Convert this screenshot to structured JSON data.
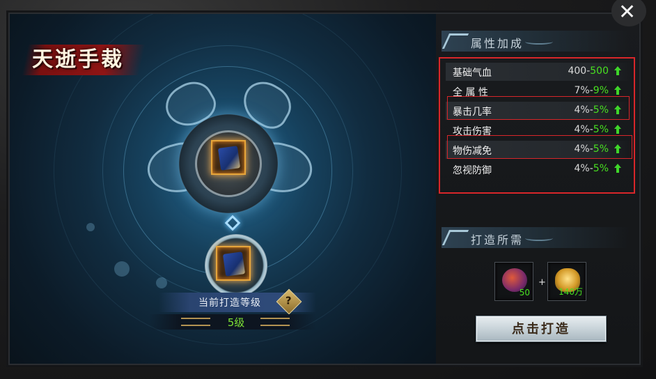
{
  "title": "天逝手裁",
  "close_icon": "close-x-icon",
  "attributes_section": {
    "header": "属性加成",
    "rows": [
      {
        "name": "基础气血",
        "from": "400",
        "to": "500"
      },
      {
        "name": "全 属 性",
        "from": "7%",
        "to": "9%"
      },
      {
        "name": "暴击几率",
        "from": "4%",
        "to": "5%"
      },
      {
        "name": "攻击伤害",
        "from": "4%",
        "to": "5%"
      },
      {
        "name": "物伤减免",
        "from": "4%",
        "to": "5%"
      },
      {
        "name": "忽视防御",
        "from": "4%",
        "to": "5%"
      }
    ]
  },
  "requirements_section": {
    "header": "打造所需",
    "materials": [
      {
        "icon": "forge-stone-icon",
        "count": "50"
      },
      {
        "icon": "gold-ingot-icon",
        "count": "140万"
      }
    ],
    "plus": "+"
  },
  "forge_button": "点击打造",
  "level": {
    "label": "当前打造等级",
    "help": "?",
    "value": "5级"
  },
  "colors": {
    "highlight_green": "#48e020",
    "annotation_red": "#d8262a",
    "up_arrow": "#3fd62a"
  }
}
